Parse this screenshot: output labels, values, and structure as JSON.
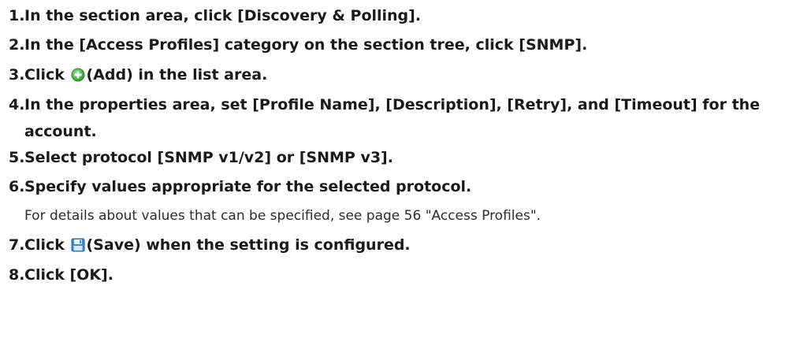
{
  "steps": [
    {
      "num": "1.",
      "text": "In the section area, click [Discovery & Polling]."
    },
    {
      "num": "2.",
      "text": "In the [Access Profiles] category on the section tree, click [SNMP]."
    },
    {
      "num": "3.",
      "pre": "Click",
      "post": "(Add) in the list area."
    },
    {
      "num": "4.",
      "text": "In the properties area, set [Profile Name], [Description], [Retry], and [Timeout] for the",
      "text_cont": "account."
    },
    {
      "num": "5.",
      "text": "Select protocol [SNMP v1/v2] or [SNMP v3]."
    },
    {
      "num": "6.",
      "text": "Specify values appropriate for the selected protocol.",
      "detail": "For details about values that can be specified, see page 56 \"Access Profiles\"."
    },
    {
      "num": "7.",
      "pre": "Click",
      "post": "(Save) when the setting is configured."
    },
    {
      "num": "8.",
      "text": "Click [OK]."
    }
  ],
  "icons": {
    "add": "add-icon",
    "save": "save-icon"
  },
  "colors": {
    "text": "#1a1a1a",
    "add_icon": "#3aae3a",
    "save_icon": "#3a8ad6"
  }
}
